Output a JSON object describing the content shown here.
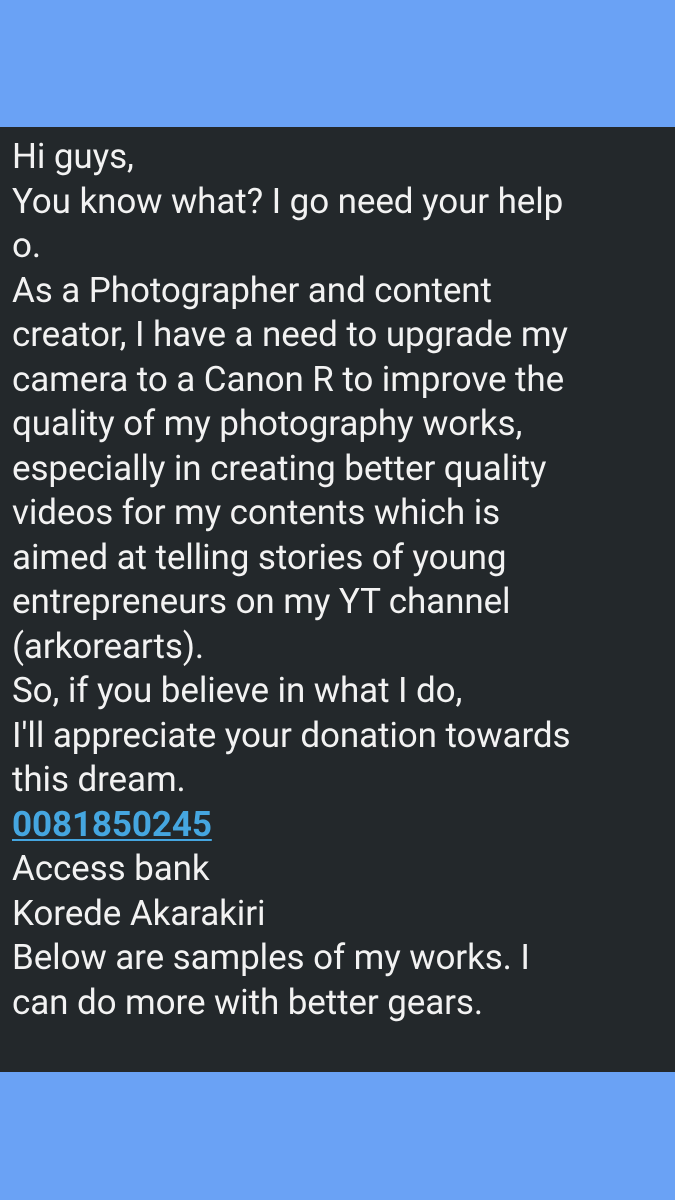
{
  "message": {
    "lines": [
      "Hi guys,",
      "You know what? I go need your help",
      "o.",
      "As a Photographer and content",
      "creator, I have a need to upgrade my",
      "camera to a Canon R to improve the",
      "quality of my photography works,",
      "especially in creating better quality",
      "videos for my contents which is",
      "aimed at telling stories of young",
      "entrepreneurs on my YT channel",
      "(arkorearts).",
      "So, if you believe in what I do,",
      "I'll appreciate your donation towards",
      "this dream."
    ],
    "account_number": "0081850245",
    "bank_name": "Access bank",
    "account_name": "Korede Akarakiri",
    "closing_lines": [
      "Below are samples of my works. I",
      "can do more with better gears."
    ]
  },
  "colors": {
    "background_band": "#6aa2f5",
    "panel": "#23282b",
    "text": "#f2f2f2",
    "link": "#45a6e0"
  }
}
